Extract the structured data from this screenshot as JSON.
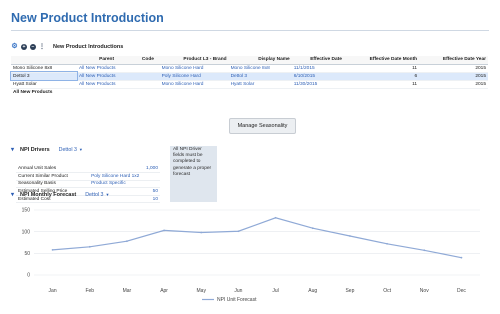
{
  "page": {
    "title": "New Product Introduction"
  },
  "toolbar": {
    "title": "New Product Introductions"
  },
  "grid": {
    "columns": [
      "",
      "Parent",
      "Code",
      "Product L3 - Brand",
      "Display Name",
      "Effective Date",
      "Effective Date Month",
      "Effective Date Year"
    ],
    "rows": [
      {
        "name": "Mono Silicone 8x8",
        "parent": "All New Products",
        "code": "",
        "brand": "Mono Silicone Hard",
        "display": "Mono Silicone 8x8",
        "date": "11/1/2015",
        "month": "11",
        "year": "2015",
        "selected": false
      },
      {
        "name": "Dettol 3",
        "parent": "All New Products",
        "code": "",
        "brand": "Poly Silicone Hard",
        "display": "Dettol 3",
        "date": "6/10/2015",
        "month": "6",
        "year": "2015",
        "selected": true
      },
      {
        "name": "Hyatt Solar",
        "parent": "All New Products",
        "code": "",
        "brand": "Mono Silicone Hard",
        "display": "Hyatt Solar",
        "date": "11/30/2015",
        "month": "11",
        "year": "2015",
        "selected": false
      }
    ],
    "total_row": "All New Products"
  },
  "drivers": {
    "title": "NPI Drivers",
    "selected": "Dettol 3",
    "rows": [
      {
        "label": "Annual Unit Sales",
        "value": "1,000"
      },
      {
        "label": "Current Similar Product",
        "value": "Poly Silicone Hard 1x2"
      },
      {
        "label": "Seasonality Basis",
        "value": "Product Specific"
      },
      {
        "label": "Estimated Selling Price",
        "value": "50"
      },
      {
        "label": "Estimated Cost",
        "value": "10"
      }
    ]
  },
  "notice": {
    "text": "All NPI Driver fields must be completed to generate a proper forecast"
  },
  "seasonality_button": {
    "label": "Manage Seasonality"
  },
  "forecast": {
    "title": "NPI Monthly Forecast",
    "selected": "Dettol 3"
  },
  "colors": {
    "accent": "#2f6bb0",
    "line": "#8fa9d6",
    "link": "#2d5fb5"
  },
  "chart_data": {
    "type": "line",
    "categories": [
      "Jan",
      "Feb",
      "Mar",
      "Apr",
      "May",
      "Jun",
      "Jul",
      "Aug",
      "Sep",
      "Oct",
      "Nov",
      "Dec"
    ],
    "series": [
      {
        "name": "NPI Unit Forecast",
        "values": [
          58,
          65,
          78,
          103,
          98,
          101,
          132,
          108,
          90,
          72,
          57,
          40
        ]
      }
    ],
    "ylim": [
      0,
      150
    ],
    "yticks": [
      0,
      50,
      100,
      150
    ],
    "grid": true,
    "legend": "bottom"
  }
}
